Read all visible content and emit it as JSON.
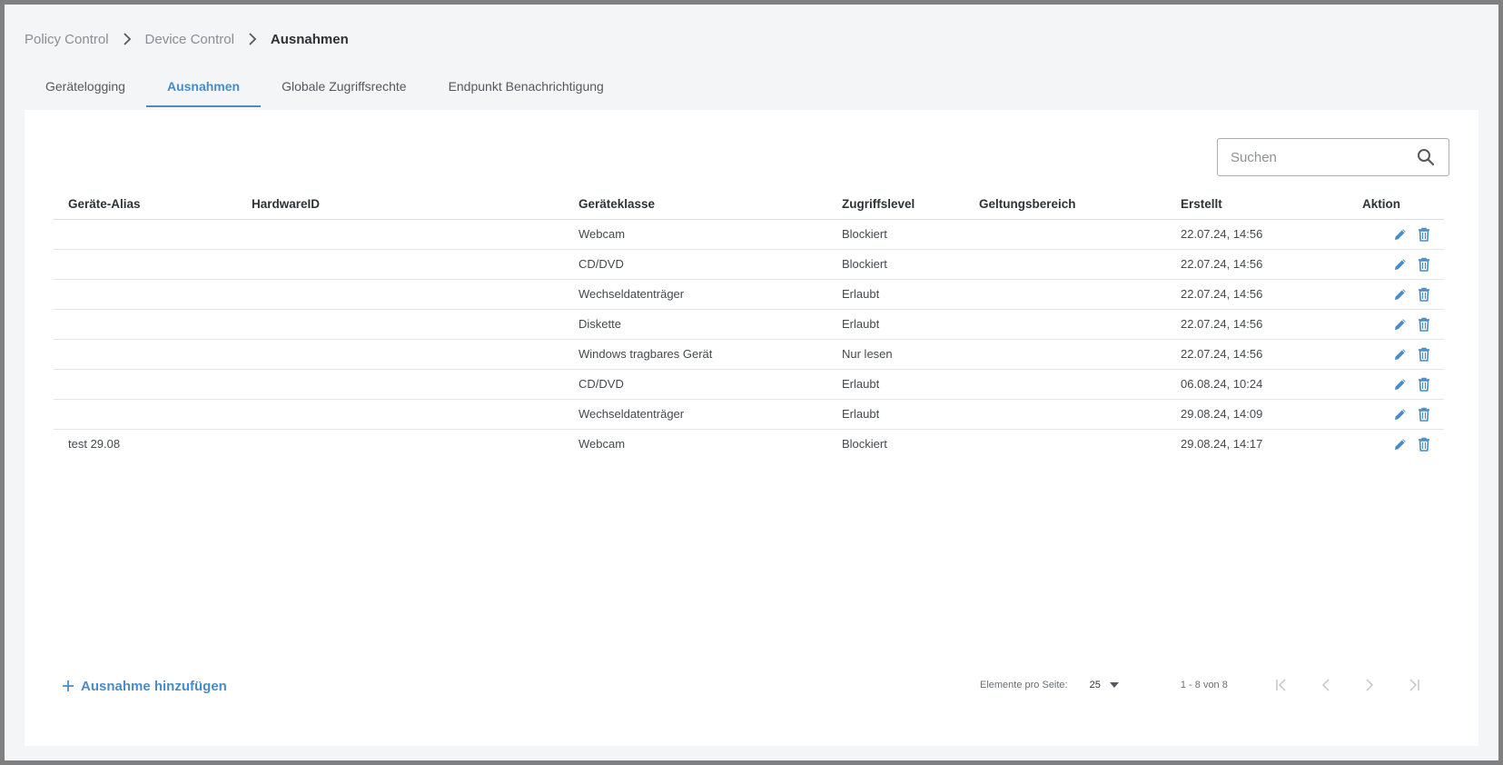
{
  "breadcrumb": {
    "items": [
      "Policy Control",
      "Device Control",
      "Ausnahmen"
    ]
  },
  "tabs": [
    {
      "label": "Gerätelogging",
      "active": false
    },
    {
      "label": "Ausnahmen",
      "active": true
    },
    {
      "label": "Globale Zugriffsrechte",
      "active": false
    },
    {
      "label": "Endpunkt Benachrichtigung",
      "active": false
    }
  ],
  "search": {
    "placeholder": "Suchen",
    "value": "",
    "icon": "search-icon"
  },
  "table": {
    "columns": {
      "alias": "Geräte-Alias",
      "hardware_id": "HardwareID",
      "device_class": "Geräteklasse",
      "access_level": "Zugriffslevel",
      "scope": "Geltungsbereich",
      "created": "Erstellt",
      "action": "Aktion"
    },
    "rows": [
      {
        "alias": "",
        "hardware_id": "",
        "device_class": "Webcam",
        "access_level": "Blockiert",
        "scope": "",
        "created": "22.07.24, 14:56"
      },
      {
        "alias": "",
        "hardware_id": "",
        "device_class": "CD/DVD",
        "access_level": "Blockiert",
        "scope": "",
        "created": "22.07.24, 14:56"
      },
      {
        "alias": "",
        "hardware_id": "",
        "device_class": "Wechseldatenträger",
        "access_level": "Erlaubt",
        "scope": "",
        "created": "22.07.24, 14:56"
      },
      {
        "alias": "",
        "hardware_id": "",
        "device_class": "Diskette",
        "access_level": "Erlaubt",
        "scope": "",
        "created": "22.07.24, 14:56"
      },
      {
        "alias": "",
        "hardware_id": "",
        "device_class": "Windows tragbares Gerät",
        "access_level": "Nur lesen",
        "scope": "",
        "created": "22.07.24, 14:56"
      },
      {
        "alias": "",
        "hardware_id": "",
        "device_class": "CD/DVD",
        "access_level": "Erlaubt",
        "scope": "",
        "created": "06.08.24, 10:24"
      },
      {
        "alias": "",
        "hardware_id": "",
        "device_class": "Wechseldatenträger",
        "access_level": "Erlaubt",
        "scope": "",
        "created": "29.08.24, 14:09"
      },
      {
        "alias": "test 29.08",
        "hardware_id": "",
        "device_class": "Webcam",
        "access_level": "Blockiert",
        "scope": "",
        "created": "29.08.24, 14:17"
      }
    ]
  },
  "footer": {
    "add_button_label": "Ausnahme hinzufügen",
    "per_page_label": "Elemente pro Seite:",
    "per_page_value": "25",
    "range_label": "1 - 8 von 8"
  },
  "colors": {
    "accent": "#4a8cc6",
    "text": "#45484d",
    "muted": "#8a8d93",
    "background": "#f4f5f7"
  }
}
